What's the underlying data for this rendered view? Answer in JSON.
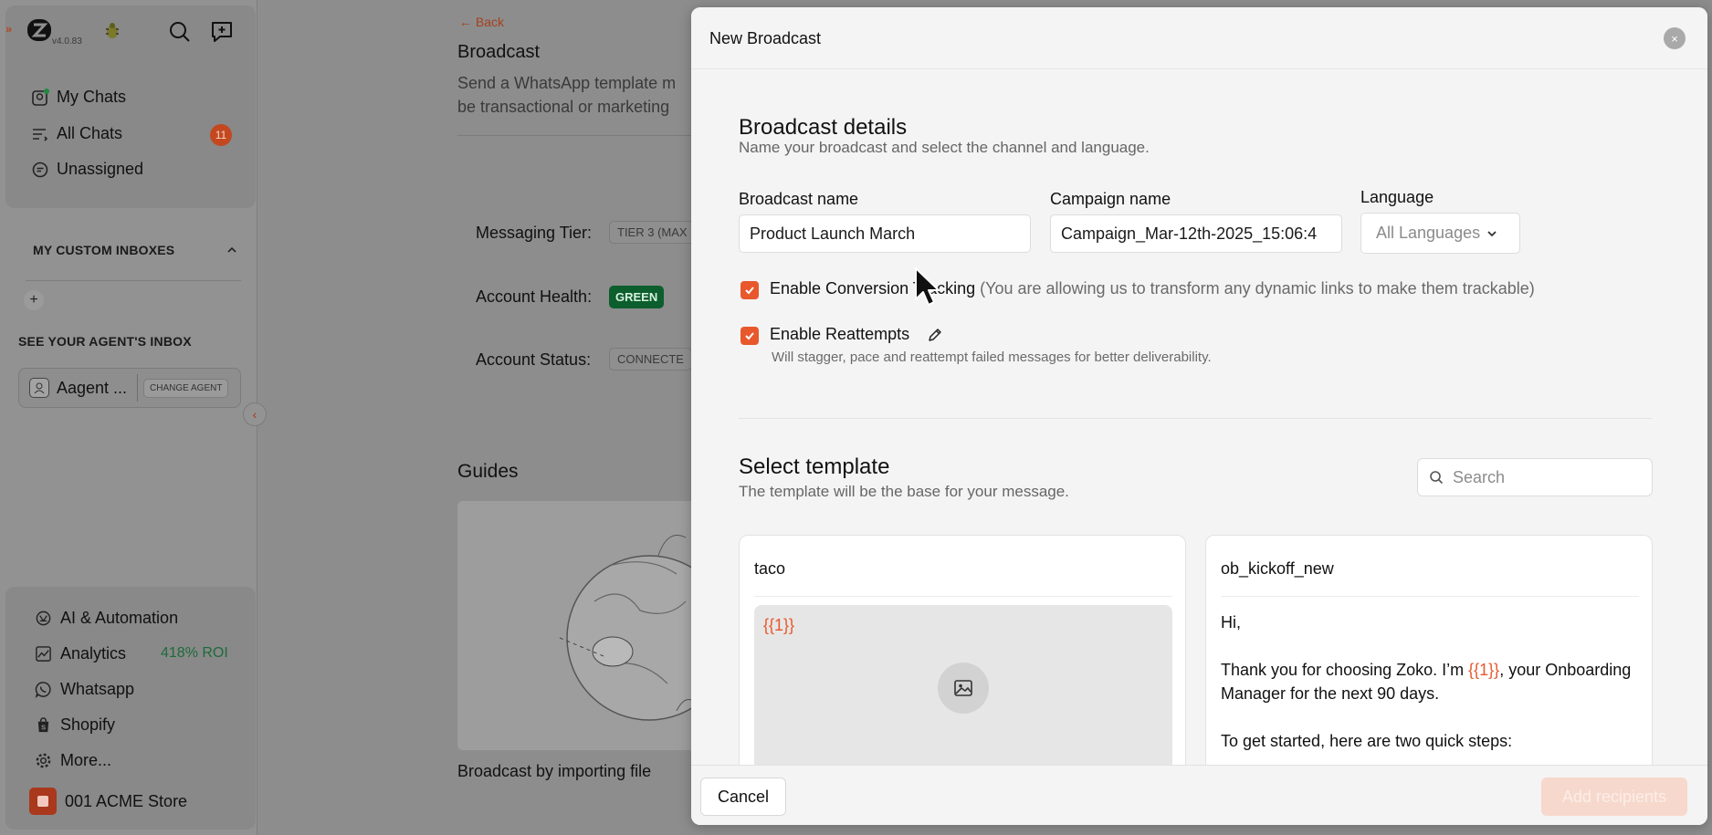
{
  "app": {
    "version": "v4.0.83"
  },
  "sidebar": {
    "nav": [
      {
        "label": "My Chats",
        "icon": "chat-bubble-icon"
      },
      {
        "label": "All Chats",
        "icon": "list-icon",
        "badge": "11"
      },
      {
        "label": "Unassigned",
        "icon": "unassigned-icon"
      }
    ],
    "custom_inboxes_title": "MY CUSTOM INBOXES",
    "add_label": "+",
    "agents_inbox_title": "SEE YOUR AGENT'S INBOX",
    "agent": {
      "name": "Aagent ...",
      "change_label": "CHANGE AGENT"
    },
    "bottom_nav": [
      {
        "label": "AI & Automation",
        "icon": "ai-icon"
      },
      {
        "label": "Analytics",
        "icon": "analytics-icon",
        "extra": "418% ROI"
      },
      {
        "label": "Whatsapp",
        "icon": "whatsapp-icon"
      },
      {
        "label": "Shopify",
        "icon": "shopify-icon"
      },
      {
        "label": "More...",
        "icon": "gear-icon"
      }
    ],
    "store_name": "001 ACME Store",
    "colors": {
      "accent": "#e8582c",
      "badge": "#c4481f",
      "roi": "#1c6b3a"
    }
  },
  "background": {
    "back_label": "← Back",
    "title": "Broadcast",
    "description_line1": "Send a WhatsApp template m",
    "description_line2": "be transactional or marketing",
    "messaging_tier_label": "Messaging Tier:",
    "messaging_tier_value": "TIER 3 (MAX",
    "account_health_label": "Account Health:",
    "account_health_value": "GREEN",
    "account_status_label": "Account Status:",
    "account_status_value": "CONNECTE",
    "guides_title": "Guides",
    "guide_caption": "Broadcast by importing file"
  },
  "modal": {
    "title": "New Broadcast",
    "close": "×",
    "details": {
      "title": "Broadcast details",
      "subtitle": "Name your broadcast and select the channel and language.",
      "broadcast_name_label": "Broadcast name",
      "broadcast_name_value": "Product Launch March",
      "campaign_name_label": "Campaign name",
      "campaign_name_value": "Campaign_Mar-12th-2025_15:06:4",
      "language_label": "Language",
      "language_value": "All Languages",
      "conversion_label": "Enable Conversion Tracking",
      "conversion_hint": "(You are allowing us to transform any dynamic links to make them trackable)",
      "conversion_checked": true,
      "reattempts_label": "Enable Reattempts",
      "reattempts_desc": "Will stagger, pace and reattempt failed messages for better deliverability.",
      "reattempts_checked": true
    },
    "template": {
      "title": "Select template",
      "subtitle": "The template will be the base for your message.",
      "search_placeholder": "Search",
      "cards": [
        {
          "name": "taco",
          "media_variable": "{{1}}"
        },
        {
          "name": "ob_kickoff_new",
          "line1": "Hi,",
          "line2_pre": "Thank you for choosing Zoko. I’m ",
          "line2_var": "{{1}}",
          "line2_post": ", your Onboarding Manager for the next 90 days.",
          "line3": "To get started, here are two quick steps:"
        }
      ]
    },
    "footer": {
      "cancel_label": "Cancel",
      "add_label": "Add recipients"
    }
  }
}
